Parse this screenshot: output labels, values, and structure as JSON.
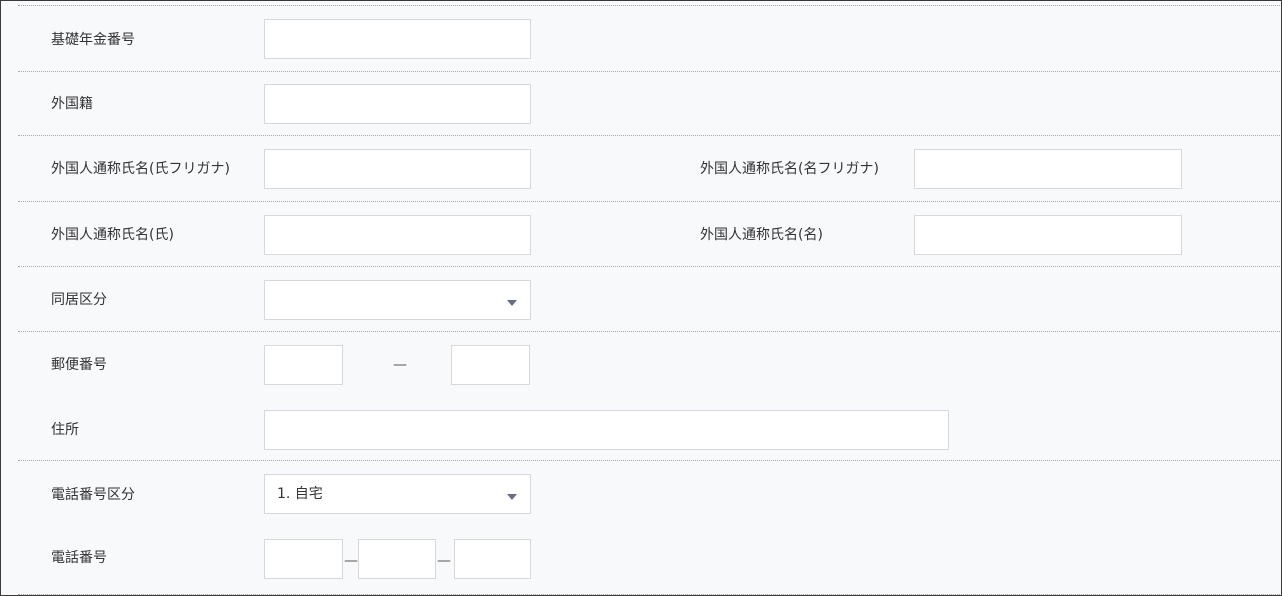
{
  "form": {
    "basic_pension_number": {
      "label": "基礎年金番号",
      "value": ""
    },
    "nationality": {
      "label": "外国籍",
      "value": ""
    },
    "alias_surname_kana": {
      "label": "外国人通称氏名(氏フリガナ)",
      "value": ""
    },
    "alias_given_kana": {
      "label": "外国人通称氏名(名フリガナ)",
      "value": ""
    },
    "alias_surname": {
      "label": "外国人通称氏名(氏)",
      "value": ""
    },
    "alias_given": {
      "label": "外国人通称氏名(名)",
      "value": ""
    },
    "cohabitation": {
      "label": "同居区分",
      "selected": ""
    },
    "postal_code": {
      "label": "郵便番号",
      "part1": "",
      "part2": "",
      "separator": "—"
    },
    "address": {
      "label": "住所",
      "value": ""
    },
    "phone_type": {
      "label": "電話番号区分",
      "selected": "1. 自宅"
    },
    "phone_number": {
      "label": "電話番号",
      "part1": "",
      "part2": "",
      "part3": "",
      "separator": "—"
    }
  },
  "icons": {
    "dropdown": "chevron-down-icon"
  },
  "colors": {
    "background": "#f8f9fb",
    "border": "#d6d8dc",
    "caret": "#676c8c"
  }
}
